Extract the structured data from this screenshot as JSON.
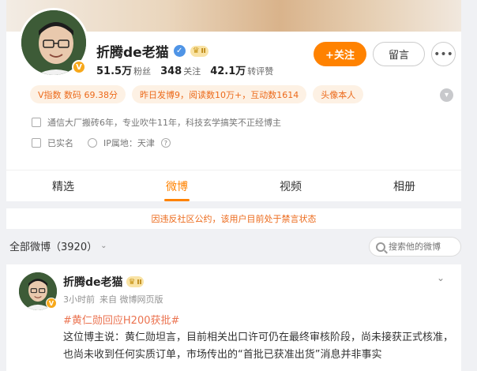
{
  "profile": {
    "name": "折腾de老猫",
    "vip_level": "II",
    "v_badge": "V",
    "stats": [
      {
        "num": "51.5万",
        "label": "粉丝"
      },
      {
        "num": "348",
        "label": "关注"
      },
      {
        "num": "42.1万",
        "label": "转评赞"
      }
    ],
    "follow_label": "+关注",
    "message_label": "留言",
    "more_label": "•••",
    "tags": [
      "V指数 数码 69.38分",
      "昨日发博9，阅读数10万+，互动数1614",
      "头像本人"
    ],
    "bio": "通信大厂搬砖6年，专业吹牛11年，科技玄学搞笑不正经博主",
    "real_name": "已实名",
    "ip_location": "IP属地：天津",
    "help_icon": "?"
  },
  "tabs": [
    {
      "label": "精选"
    },
    {
      "label": "微博"
    },
    {
      "label": "视频"
    },
    {
      "label": "相册"
    }
  ],
  "notice": "因违反社区公约，该用户目前处于禁言状态",
  "feed": {
    "header": "全部微博（3920）",
    "search_placeholder": "搜索他的微博"
  },
  "post": {
    "name": "折腾de老猫",
    "vip_level": "II",
    "time": "3小时前",
    "source": "来自 微博网页版",
    "hashtag": "#黄仁勋回应H200获批#",
    "body": "这位博主说：黄仁勋坦言，目前相关出口许可仍在最终审核阶段，尚未接获正式核准，也尚未收到任何实质订单，市场传出的“首批已获准出货”消息并非事实"
  },
  "colors": {
    "accent": "#ff8200",
    "tag_text": "#ec6a1b",
    "tag_bg": "#fdf1e4",
    "hashtag": "#eb7350"
  }
}
